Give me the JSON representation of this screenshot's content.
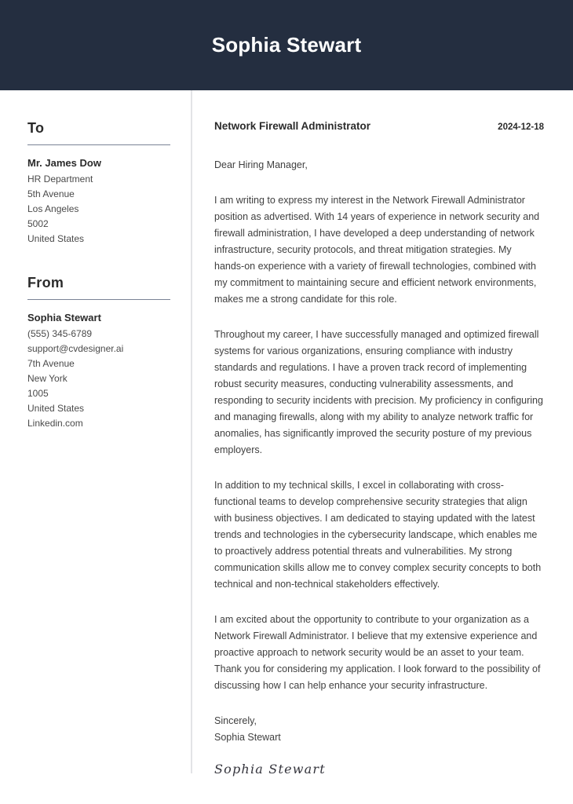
{
  "header": {
    "name": "Sophia Stewart",
    "background_color": "#242e40",
    "text_color": "#ffffff"
  },
  "sidebar": {
    "to": {
      "heading": "To",
      "name": "Mr. James Dow",
      "lines": [
        "HR Department",
        "5th Avenue",
        "Los Angeles",
        "5002",
        "United States"
      ]
    },
    "from": {
      "heading": "From",
      "name": "Sophia Stewart",
      "lines": [
        "(555) 345-6789",
        "support@cvdesigner.ai",
        "7th Avenue",
        "New York",
        "1005",
        "United States",
        "Linkedin.com"
      ]
    }
  },
  "letter": {
    "job_title": "Network Firewall Administrator",
    "date": "2024-12-18",
    "salutation": "Dear Hiring Manager,",
    "paragraphs": [
      "I am writing to express my interest in the Network Firewall Administrator position as advertised. With 14 years of experience in network security and firewall administration, I have developed a deep understanding of network infrastructure, security protocols, and threat mitigation strategies. My hands-on experience with a variety of firewall technologies, combined with my commitment to maintaining secure and efficient network environments, makes me a strong candidate for this role.",
      "Throughout my career, I have successfully managed and optimized firewall systems for various organizations, ensuring compliance with industry standards and regulations. I have a proven track record of implementing robust security measures, conducting vulnerability assessments, and responding to security incidents with precision. My proficiency in configuring and managing firewalls, along with my ability to analyze network traffic for anomalies, has significantly improved the security posture of my previous employers.",
      "In addition to my technical skills, I excel in collaborating with cross-functional teams to develop comprehensive security strategies that align with business objectives. I am dedicated to staying updated with the latest trends and technologies in the cybersecurity landscape, which enables me to proactively address potential threats and vulnerabilities. My strong communication skills allow me to convey complex security concepts to both technical and non-technical stakeholders effectively.",
      "I am excited about the opportunity to contribute to your organization as a Network Firewall Administrator. I believe that my extensive experience and proactive approach to network security would be an asset to your team. Thank you for considering my application. I look forward to the possibility of discussing how I can help enhance your security infrastructure."
    ],
    "closing_salutation": "Sincerely,",
    "closing_name": "Sophia Stewart",
    "signature": "Sophia Stewart"
  }
}
